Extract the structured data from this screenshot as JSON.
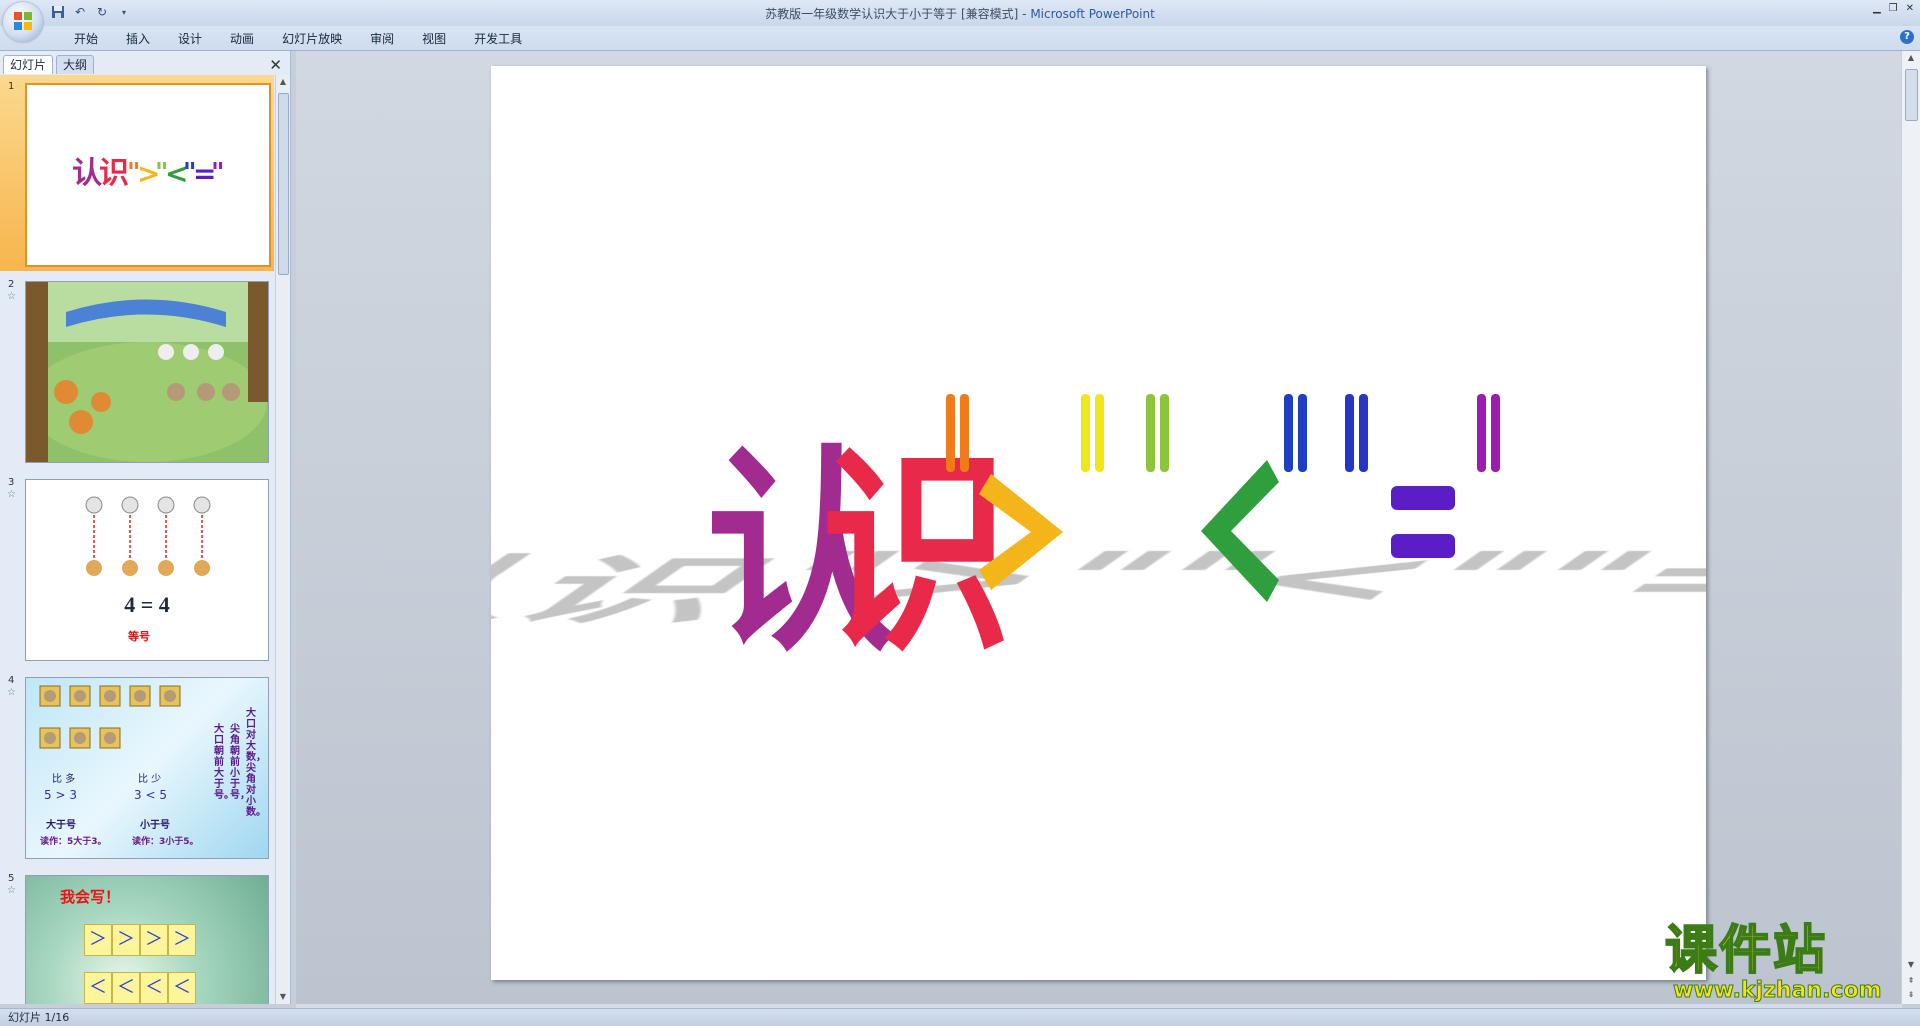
{
  "window": {
    "title": "苏教版一年级数学认识大于小于等于 [兼容模式] - ",
    "app_name": "Microsoft PowerPoint"
  },
  "ribbon": {
    "tabs": [
      "开始",
      "插入",
      "设计",
      "动画",
      "幻灯片放映",
      "审阅",
      "视图",
      "开发工具"
    ]
  },
  "slide_pane": {
    "tabs": [
      "幻灯片",
      "大纲"
    ],
    "slide_numbers": [
      "1",
      "2",
      "3",
      "4",
      "5"
    ],
    "thumb3": {
      "eq": "4 = 4",
      "label": "等号"
    },
    "thumb4": {
      "compare_more": "比    多",
      "compare_less": "比    少",
      "gt_expr": "5 > 3",
      "lt_expr": "3 < 5",
      "gt_name": "大于号",
      "lt_name": "小于号",
      "read_gt": "读作：5大于3。",
      "read_lt": "读作：3小于5。",
      "rhyme1": "大口对大数，尖角对小数。",
      "rhyme2": "尖角朝前小于号，",
      "rhyme3": "大口朝前大于号。"
    },
    "thumb5": {
      "title": "我会写！",
      "gt_symbols": [
        "＞",
        "＞",
        "＞",
        "＞"
      ],
      "lt_symbols": [
        "＜",
        "＜",
        "＜",
        "＜"
      ]
    }
  },
  "slide": {
    "title_chars": [
      "认",
      "识"
    ],
    "symbols": [
      "\"",
      "＞",
      "\"",
      "\"",
      "＜",
      "\"",
      "\"",
      "=",
      "\""
    ],
    "colors": {
      "ren": "#a22b8f",
      "shi": "#e8294a",
      "q1": "#f17a1a",
      "gt": "#f4b51b",
      "q2": "#f0e61a",
      "q3": "#8cc53a",
      "lt": "#2f9e3c",
      "q4": "#1f3fc2",
      "q5": "#2336c7",
      "eq": "#5b1ec6",
      "q6": "#9b1cb0",
      "shadow": "#c4c4c4"
    }
  },
  "status": {
    "text": "幻灯片 1/16"
  },
  "watermark": {
    "cn": "课件站",
    "url": "www.kjzhan.com"
  }
}
